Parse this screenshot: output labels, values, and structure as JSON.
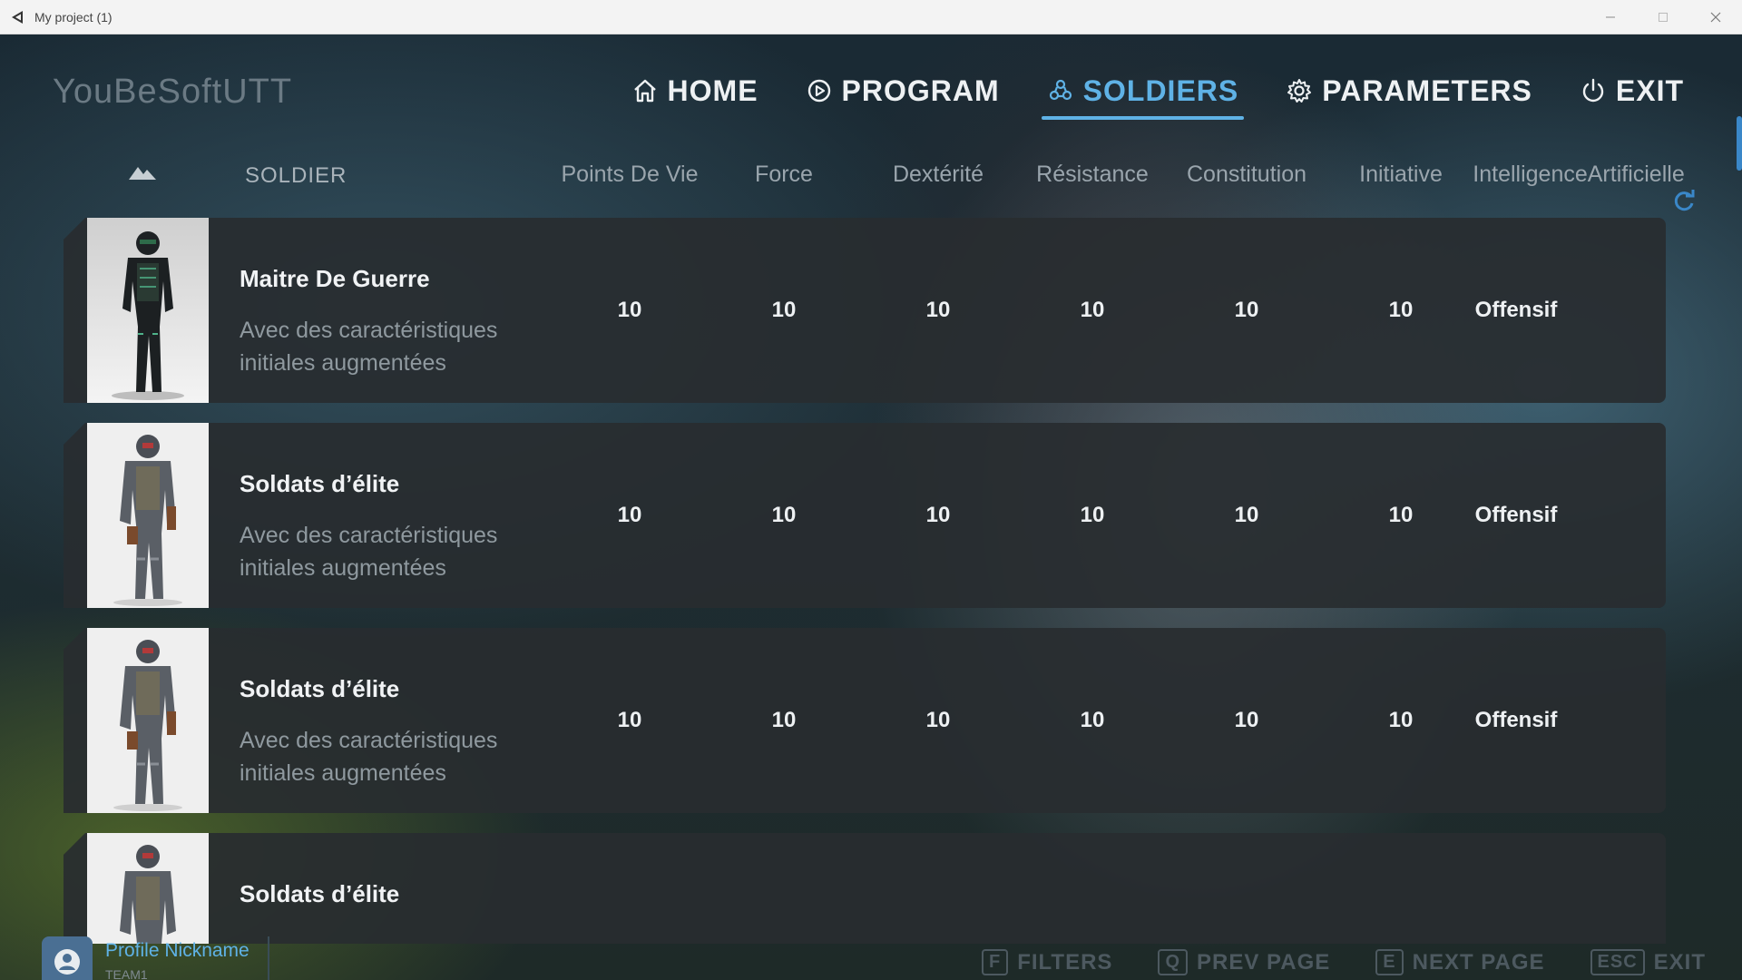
{
  "window": {
    "title": "My project (1)"
  },
  "brand": "YouBeSoftUTT",
  "nav": [
    {
      "label": "HOME",
      "icon": "home-icon",
      "active": false
    },
    {
      "label": "PROGRAM",
      "icon": "play-circle-icon",
      "active": false
    },
    {
      "label": "SOLDIERS",
      "icon": "soldiers-icon",
      "active": true
    },
    {
      "label": "PARAMETERS",
      "icon": "gear-icon",
      "active": false
    },
    {
      "label": "EXIT",
      "icon": "power-icon",
      "active": false
    }
  ],
  "accent_color": "#5fb2e6",
  "columns": {
    "soldier": "SOLDIER",
    "stats": [
      "Points De Vie",
      "Force",
      "Dextérité",
      "Résistance",
      "Constitution",
      "Initiative",
      "IntelligenceArtificielle"
    ]
  },
  "rows": [
    {
      "name": "Maitre De Guerre",
      "description": "Avec des caractéristiques initiales augmentées",
      "stats": [
        "10",
        "10",
        "10",
        "10",
        "10",
        "10"
      ],
      "ai": "Offensif"
    },
    {
      "name": "Soldats d’élite",
      "description": "Avec des caractéristiques initiales augmentées",
      "stats": [
        "10",
        "10",
        "10",
        "10",
        "10",
        "10"
      ],
      "ai": "Offensif"
    },
    {
      "name": "Soldats d’élite",
      "description": "Avec des caractéristiques initiales augmentées",
      "stats": [
        "10",
        "10",
        "10",
        "10",
        "10",
        "10"
      ],
      "ai": "Offensif"
    },
    {
      "name": "Soldats d’élite"
    }
  ],
  "profile": {
    "nickname": "Profile Nickname",
    "team": "TEAM1"
  },
  "footer": [
    {
      "key": "F",
      "label": "FILTERS"
    },
    {
      "key": "Q",
      "label": "PREV PAGE"
    },
    {
      "key": "E",
      "label": "NEXT PAGE"
    },
    {
      "key": "ESC",
      "label": "EXIT"
    }
  ]
}
